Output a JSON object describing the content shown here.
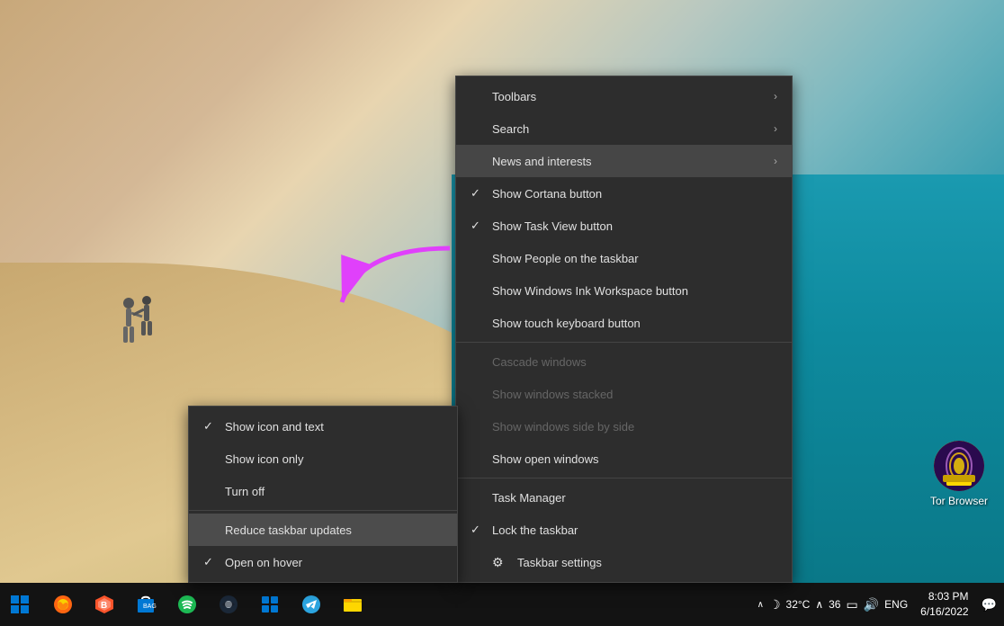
{
  "desktop": {
    "background": "beach scene"
  },
  "mainContextMenu": {
    "items": [
      {
        "id": "toolbars",
        "label": "Toolbars",
        "hasArrow": true,
        "check": "",
        "disabled": false,
        "separator_after": false
      },
      {
        "id": "search",
        "label": "Search",
        "hasArrow": true,
        "check": "",
        "disabled": false,
        "separator_after": false
      },
      {
        "id": "news-interests",
        "label": "News and interests",
        "hasArrow": true,
        "check": "",
        "disabled": false,
        "highlighted": true,
        "separator_after": false
      },
      {
        "id": "cortana",
        "label": "Show Cortana button",
        "hasArrow": false,
        "check": "✓",
        "disabled": false,
        "separator_after": false
      },
      {
        "id": "task-view",
        "label": "Show Task View button",
        "hasArrow": false,
        "check": "✓",
        "disabled": false,
        "separator_after": false
      },
      {
        "id": "people",
        "label": "Show People on the taskbar",
        "hasArrow": false,
        "check": "",
        "disabled": false,
        "separator_after": false
      },
      {
        "id": "ink-workspace",
        "label": "Show Windows Ink Workspace button",
        "hasArrow": false,
        "check": "",
        "disabled": false,
        "separator_after": false
      },
      {
        "id": "touch-keyboard",
        "label": "Show touch keyboard button",
        "hasArrow": false,
        "check": "",
        "disabled": false,
        "separator_after": true
      },
      {
        "id": "cascade",
        "label": "Cascade windows",
        "hasArrow": false,
        "check": "",
        "disabled": true,
        "separator_after": false
      },
      {
        "id": "stacked",
        "label": "Show windows stacked",
        "hasArrow": false,
        "check": "",
        "disabled": true,
        "separator_after": false
      },
      {
        "id": "side-by-side",
        "label": "Show windows side by side",
        "hasArrow": false,
        "check": "",
        "disabled": true,
        "separator_after": false
      },
      {
        "id": "open-windows",
        "label": "Show open windows",
        "hasArrow": false,
        "check": "",
        "disabled": false,
        "separator_after": true
      },
      {
        "id": "task-manager",
        "label": "Task Manager",
        "hasArrow": false,
        "check": "",
        "disabled": false,
        "separator_after": false
      },
      {
        "id": "lock-taskbar",
        "label": "Lock the taskbar",
        "hasArrow": false,
        "check": "✓",
        "disabled": false,
        "separator_after": false
      },
      {
        "id": "taskbar-settings",
        "label": "Taskbar settings",
        "hasArrow": false,
        "check": "",
        "hasGear": true,
        "disabled": false,
        "separator_after": false
      }
    ]
  },
  "subContextMenu": {
    "items": [
      {
        "id": "show-icon-text",
        "label": "Show icon and text",
        "check": "✓",
        "highlighted": false
      },
      {
        "id": "show-icon-only",
        "label": "Show icon only",
        "check": "",
        "highlighted": false
      },
      {
        "id": "turn-off",
        "label": "Turn off",
        "check": "",
        "highlighted": false,
        "separator_after": true
      },
      {
        "id": "reduce-updates",
        "label": "Reduce taskbar updates",
        "check": "",
        "highlighted": true
      },
      {
        "id": "open-hover",
        "label": "Open on hover",
        "check": "✓",
        "highlighted": false
      }
    ]
  },
  "torBrowser": {
    "label": "Tor Browser"
  },
  "taskbar": {
    "systemTray": {
      "temp": "32°C",
      "wifi_bars": "36",
      "lang": "ENG",
      "time": "8:03 PM",
      "date": "6/16/2022"
    }
  }
}
